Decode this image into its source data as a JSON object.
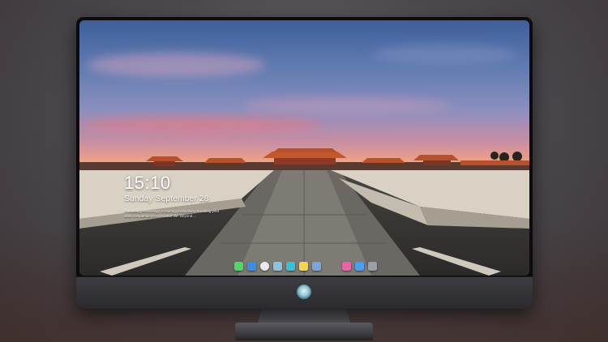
{
  "lockscreen": {
    "time": "15:10",
    "date": "Sunday September 28",
    "tagline": "Innovating technology. Ensuring productivity. Boosting your ideal companion for a smarter life. Beyond..."
  },
  "dock": {
    "icons": [
      {
        "name": "messages-icon",
        "color": "#4cd964"
      },
      {
        "name": "finder-icon",
        "color": "#3a8ee6"
      },
      {
        "name": "safari-icon",
        "color": "#e9e9ee"
      },
      {
        "name": "notes-icon",
        "color": "#8cc4e0"
      },
      {
        "name": "clapper-icon",
        "color": "#34c3d8"
      },
      {
        "name": "stickies-icon",
        "color": "#f5d547"
      },
      {
        "name": "preview-icon",
        "color": "#79a8d8"
      },
      {
        "name": "music-icon",
        "color": "#ef5fa8"
      },
      {
        "name": "appstore-icon",
        "color": "#4a9ff5"
      },
      {
        "name": "camera-icon",
        "color": "#9aa0a8"
      }
    ]
  },
  "colors": {
    "accent_sky": "#5f7bb0",
    "sunset": "#e49a8d",
    "roof": "#b8502c"
  }
}
